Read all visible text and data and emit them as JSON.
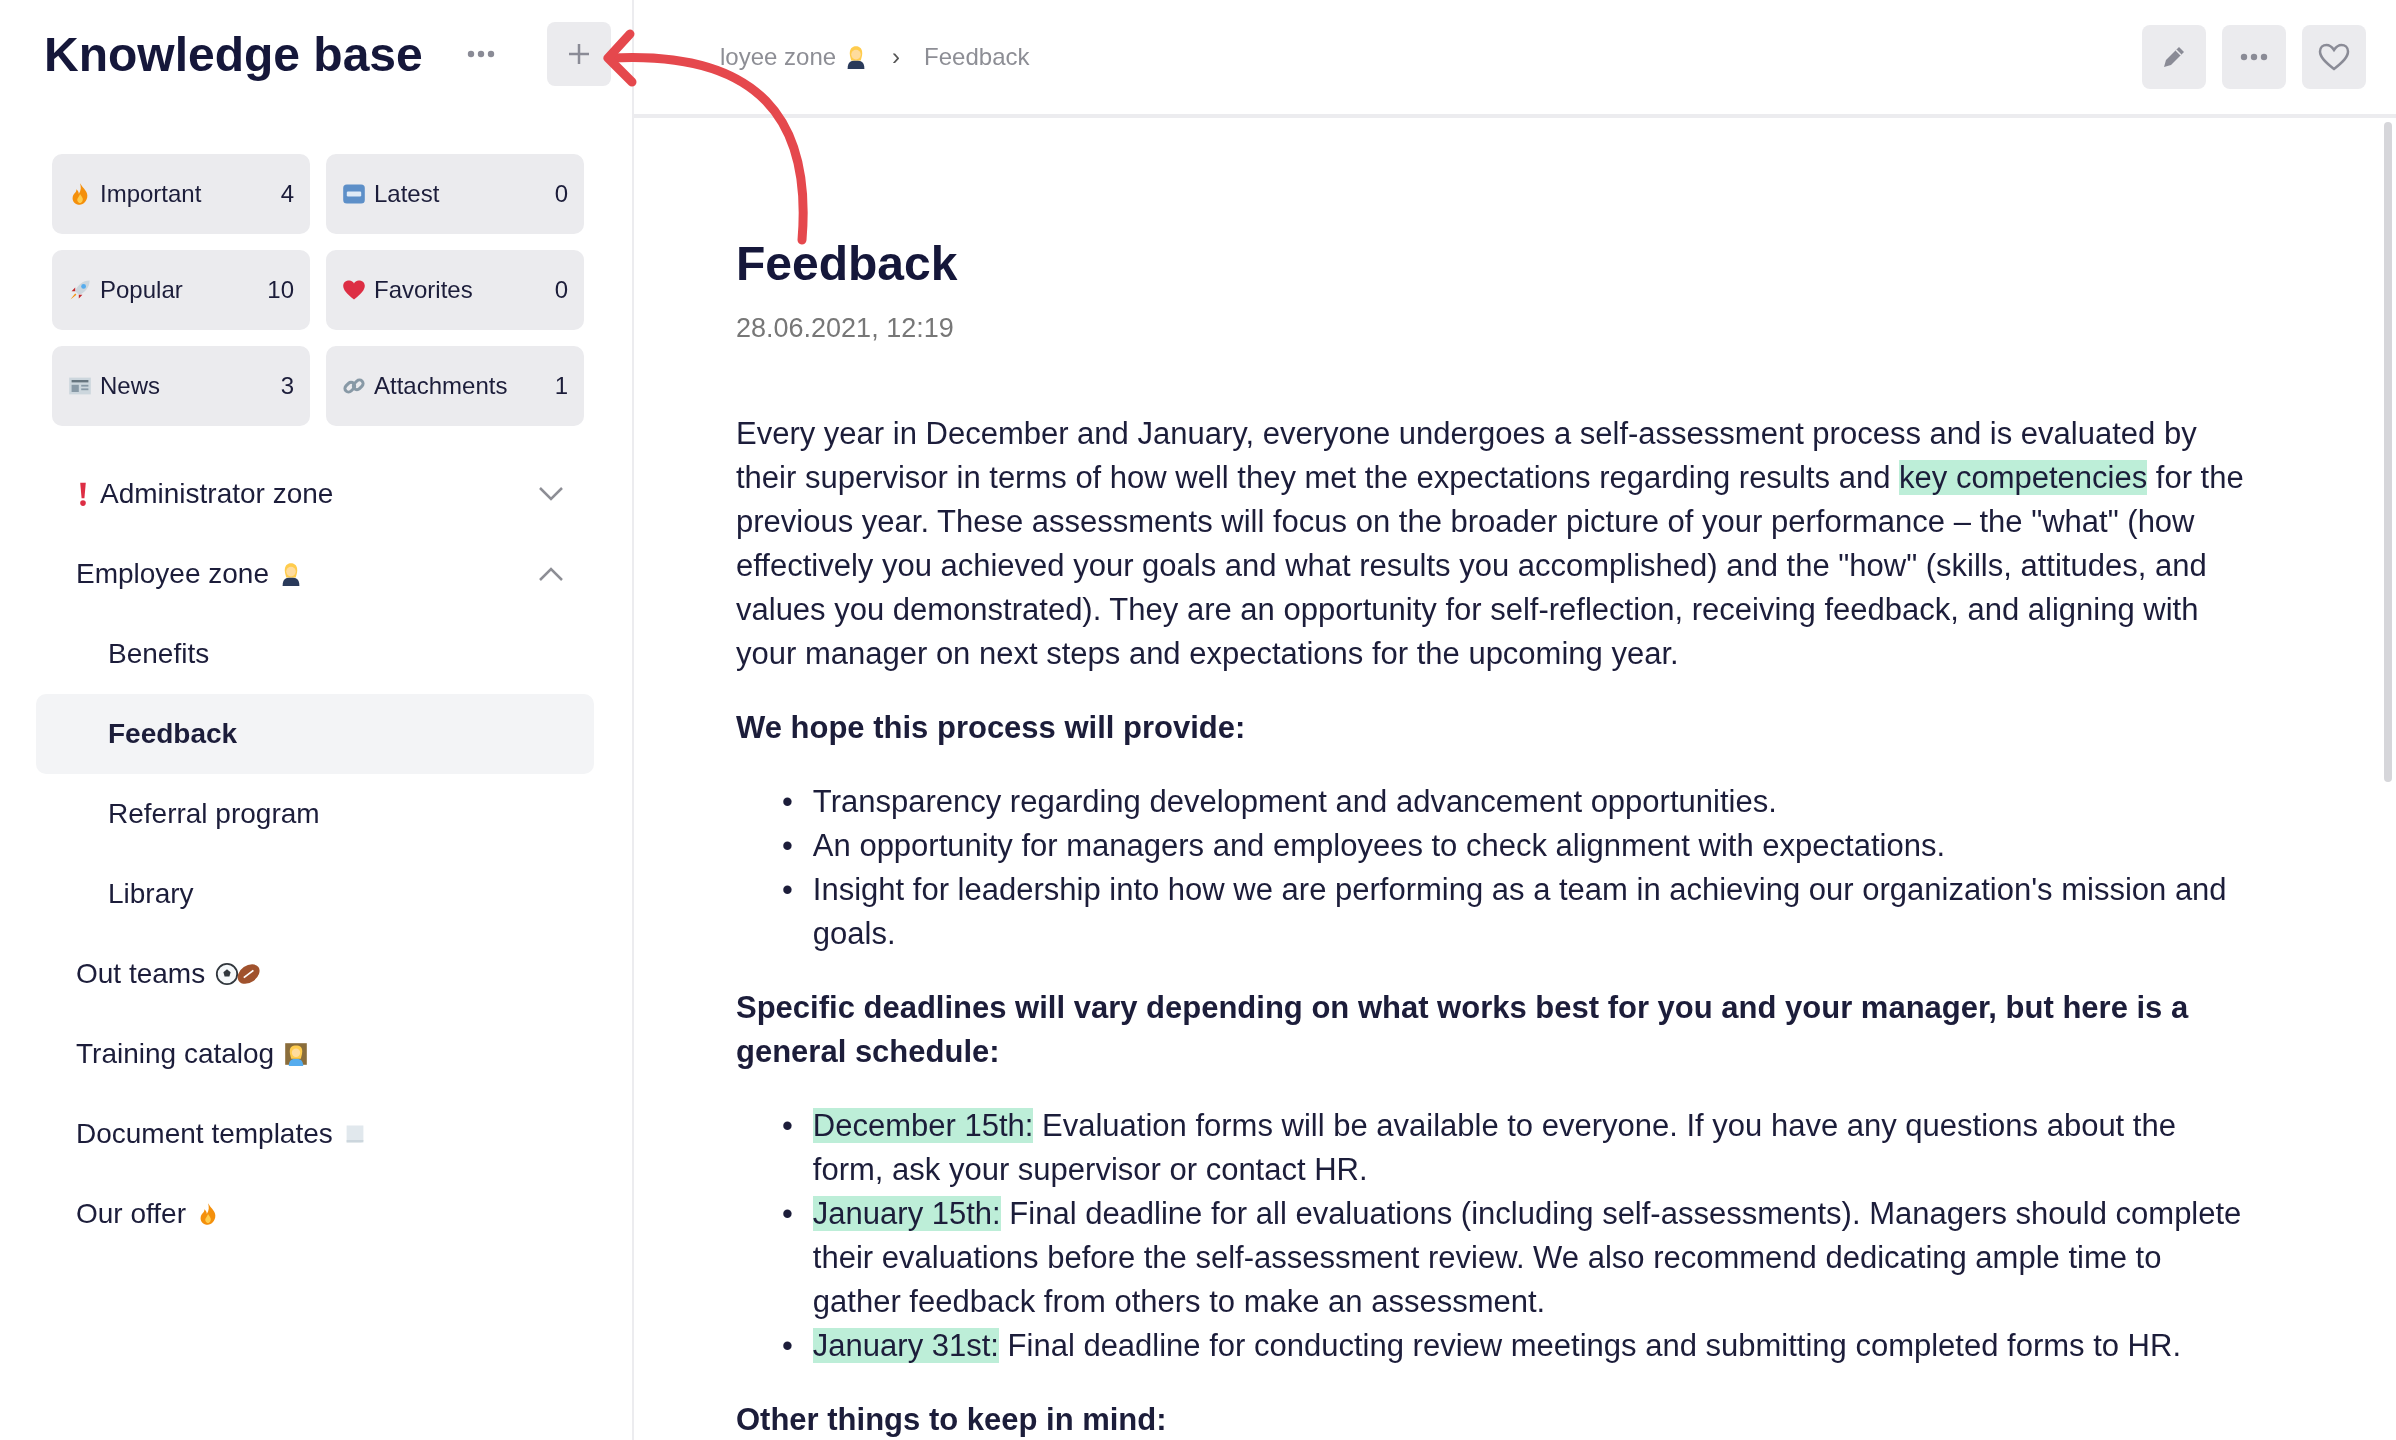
{
  "sidebar": {
    "title": "Knowledge base",
    "tiles": [
      {
        "label": "Important",
        "count": "4"
      },
      {
        "label": "Latest",
        "count": "0"
      },
      {
        "label": "Popular",
        "count": "10"
      },
      {
        "label": "Favorites",
        "count": "0"
      },
      {
        "label": "News",
        "count": "3"
      },
      {
        "label": "Attachments",
        "count": "1"
      }
    ],
    "nav": [
      {
        "label": "Administrator zone",
        "expanded": false,
        "selected": false
      },
      {
        "label": "Employee zone",
        "expanded": true,
        "selected": false,
        "children": [
          {
            "label": "Benefits",
            "selected": false
          },
          {
            "label": "Feedback",
            "selected": true
          },
          {
            "label": "Referral program",
            "selected": false
          },
          {
            "label": "Library",
            "selected": false
          }
        ]
      },
      {
        "label": "Out teams",
        "selected": false
      },
      {
        "label": "Training catalog",
        "selected": false
      },
      {
        "label": "Document templates",
        "selected": false
      },
      {
        "label": "Our offer",
        "selected": false
      }
    ]
  },
  "breadcrumb": [
    {
      "label": "loyee zone"
    },
    {
      "label": "Feedback"
    }
  ],
  "breadcrumb_separator": "›",
  "article": {
    "title": "Feedback",
    "date": "28.06.2021, 12:19",
    "blocks": [
      {
        "kind": "paragraph",
        "segments": [
          {
            "text": "Every year in December and January, everyone undergoes a self-assessment process and is evaluated by their supervisor in terms of how well they met the expectations regarding results and ",
            "highlight": false
          },
          {
            "text": "key competencies",
            "highlight": true
          },
          {
            "text": " for the previous year. These assessments will focus on the broader picture of your performance – the \"what\" (how effectively you achieved your goals and what results you accomplished) and the \"how\" (skills, attitudes, and values you demonstrated). They are an opportunity for self-reflection, receiving feedback, and aligning with your manager on next steps and expectations for the upcoming year.",
            "highlight": false
          }
        ]
      },
      {
        "kind": "heading",
        "text": "We hope this process will provide:"
      },
      {
        "kind": "list",
        "bullet": "•",
        "items": [
          {
            "segments": [
              {
                "text": "Transparency regarding development and advancement opportunities.",
                "highlight": false
              }
            ]
          },
          {
            "segments": [
              {
                "text": "An opportunity for managers and employees to check alignment with expectations.",
                "highlight": false
              }
            ]
          },
          {
            "segments": [
              {
                "text": "Insight for leadership into how we are performing as a team in achieving our organization's mission and goals.",
                "highlight": false
              }
            ]
          }
        ]
      },
      {
        "kind": "heading",
        "text": "Specific deadlines will vary depending on what works best for you and your manager, but here is a general schedule:"
      },
      {
        "kind": "list",
        "bullet": "•",
        "items": [
          {
            "segments": [
              {
                "text": "December 15th:",
                "highlight": true
              },
              {
                "text": " Evaluation forms will be available to everyone. If you have any questions about the form, ask your supervisor or contact HR.",
                "highlight": false
              }
            ]
          },
          {
            "segments": [
              {
                "text": "January 15th:",
                "highlight": true
              },
              {
                "text": " Final deadline for all evaluations (including self-assessments). Managers should complete their evaluations before the self-assessment review. We also recommend dedicating ample time to gather feedback from others to make an assessment.",
                "highlight": false
              }
            ]
          },
          {
            "segments": [
              {
                "text": "January 31st:",
                "highlight": true
              },
              {
                "text": " Final deadline for conducting review meetings and submitting completed forms to HR.",
                "highlight": false
              }
            ]
          }
        ]
      },
      {
        "kind": "heading",
        "text": "Other things to keep in mind:"
      }
    ]
  }
}
